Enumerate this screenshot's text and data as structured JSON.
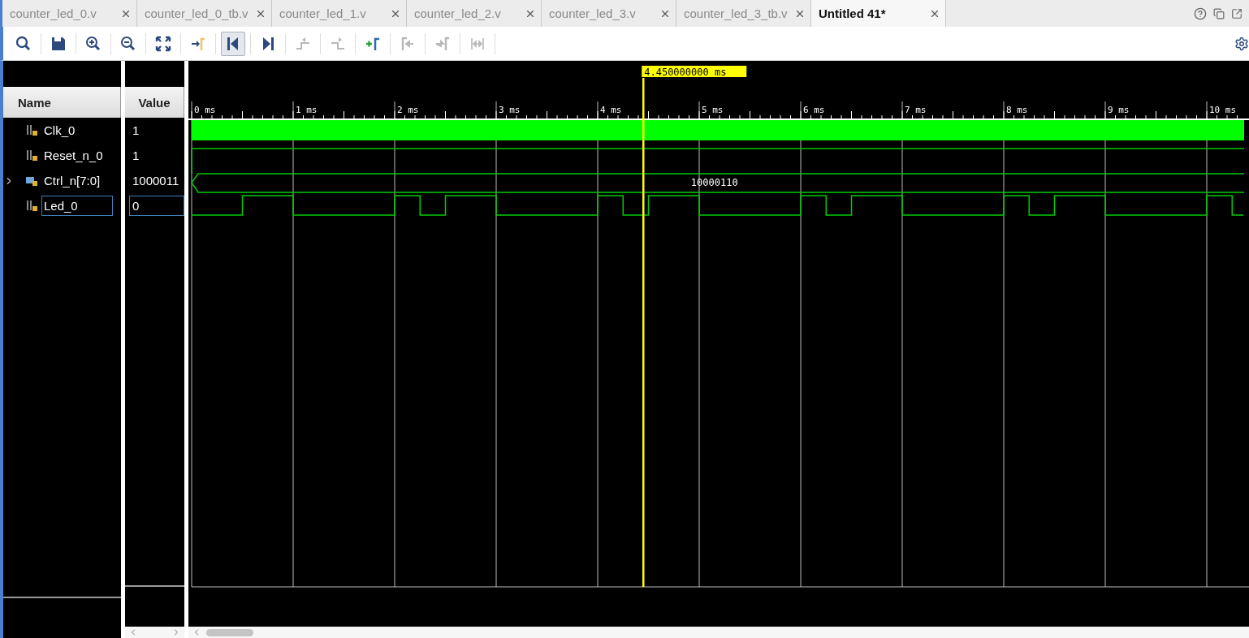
{
  "tabs": [
    {
      "label": "counter_led_0.v",
      "selected": false
    },
    {
      "label": "counter_led_0_tb.v",
      "selected": false
    },
    {
      "label": "counter_led_1.v",
      "selected": false
    },
    {
      "label": "counter_led_2.v",
      "selected": false
    },
    {
      "label": "counter_led_3.v",
      "selected": false
    },
    {
      "label": "counter_led_3_tb.v",
      "selected": false
    },
    {
      "label": "Untitled 41*",
      "selected": true
    }
  ],
  "toolbar": [
    {
      "kind": "search",
      "disabled": false,
      "selected": false
    },
    {
      "kind": "save",
      "disabled": false,
      "selected": false
    },
    {
      "kind": "zoom-in",
      "disabled": false,
      "selected": false
    },
    {
      "kind": "zoom-out",
      "disabled": false,
      "selected": false
    },
    {
      "kind": "fit",
      "disabled": false,
      "selected": false
    },
    {
      "kind": "goto-cursor",
      "disabled": false,
      "selected": false
    },
    {
      "kind": "goto-start",
      "disabled": false,
      "selected": true
    },
    {
      "kind": "goto-end",
      "disabled": false,
      "selected": false
    },
    {
      "kind": "prev-transition",
      "disabled": true,
      "selected": false
    },
    {
      "kind": "next-transition",
      "disabled": true,
      "selected": false
    },
    {
      "kind": "add-marker",
      "disabled": false,
      "selected": false
    },
    {
      "kind": "prev-marker",
      "disabled": true,
      "selected": false
    },
    {
      "kind": "next-marker",
      "disabled": true,
      "selected": false
    },
    {
      "kind": "swap-cursors",
      "disabled": true,
      "selected": false
    }
  ],
  "columns": {
    "name": "Name",
    "value": "Value"
  },
  "signals": [
    {
      "name": "Clk_0",
      "value": "1",
      "kind": "bit",
      "selected": false
    },
    {
      "name": "Reset_n_0",
      "value": "1",
      "kind": "bit",
      "selected": false
    },
    {
      "name": "Ctrl_n[7:0]",
      "value": "1000011",
      "kind": "bus",
      "selected": false,
      "expanded": false
    },
    {
      "name": "Led_0",
      "value": "0",
      "kind": "bit",
      "selected": true
    }
  ],
  "waveform": {
    "cursor": "4.450000000 ms",
    "ticks": [
      "0 ms",
      "1 ms",
      "2 ms",
      "3 ms",
      "4 ms",
      "5 ms",
      "6 ms",
      "7 ms",
      "8 ms",
      "9 ms",
      "10 ms"
    ],
    "bus_value": "10000110"
  }
}
